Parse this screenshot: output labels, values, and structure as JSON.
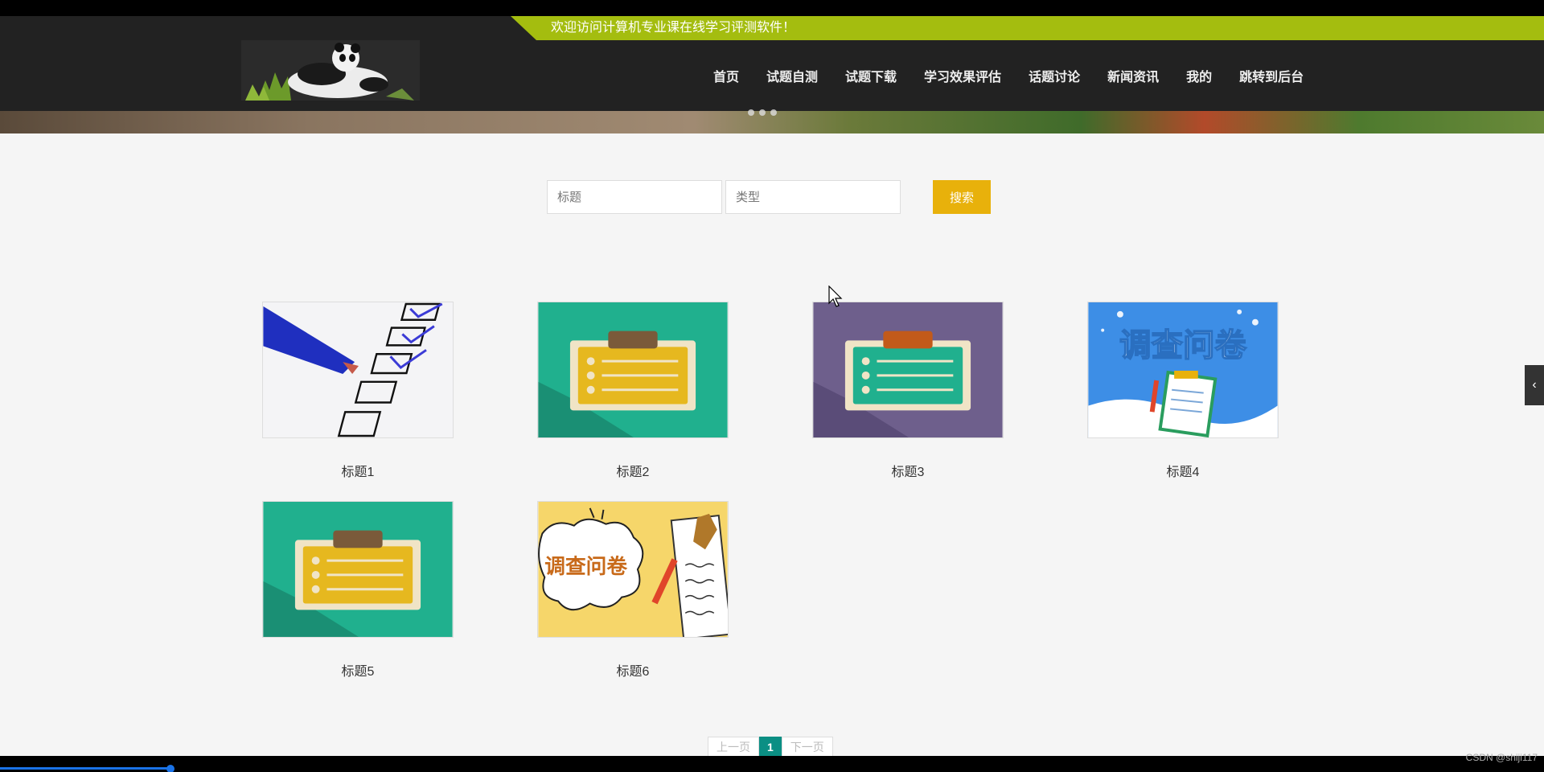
{
  "header": {
    "welcome": "欢迎访问计算机专业课在线学习评测软件！",
    "nav": [
      "首页",
      "试题自测",
      "试题下载",
      "学习效果评估",
      "话题讨论",
      "新闻资讯",
      "我的",
      "跳转到后台"
    ]
  },
  "search": {
    "title_placeholder": "标题",
    "type_placeholder": "类型",
    "button": "搜索"
  },
  "items": [
    {
      "title": "标题1",
      "image": "checklist-image"
    },
    {
      "title": "标题2",
      "image": "clipboard-image-teal"
    },
    {
      "title": "标题3",
      "image": "clipboard-image-purple"
    },
    {
      "title": "标题4",
      "image": "survey-banner-image"
    },
    {
      "title": "标题5",
      "image": "clipboard-image-teal"
    },
    {
      "title": "标题6",
      "image": "survey-comic-image"
    }
  ],
  "survey_image_text": "调查问卷",
  "pagination": {
    "prev": "上一页",
    "current": "1",
    "next": "下一页"
  },
  "watermark": "CSDN @shiji117",
  "colors": {
    "header_bg": "#222222",
    "welcome_bar": "#a4bd0f",
    "search_button": "#e8b10b",
    "pager_active": "#0b8f84"
  }
}
